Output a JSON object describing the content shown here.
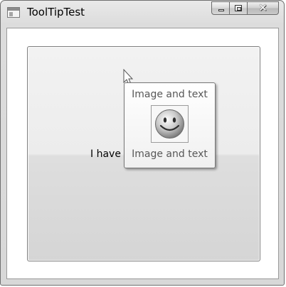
{
  "window": {
    "title": "ToolTipTest"
  },
  "caption_buttons": {
    "minimize_icon": "minimize-icon",
    "maximize_icon": "maximize-icon",
    "close_glyph": "✕"
  },
  "main_button": {
    "label": "I have"
  },
  "tooltip": {
    "top_text": "Image and text",
    "bottom_text": "Image and text",
    "image_icon": "smiley-face-icon"
  },
  "cursor": {
    "icon": "arrow-cursor-icon"
  }
}
